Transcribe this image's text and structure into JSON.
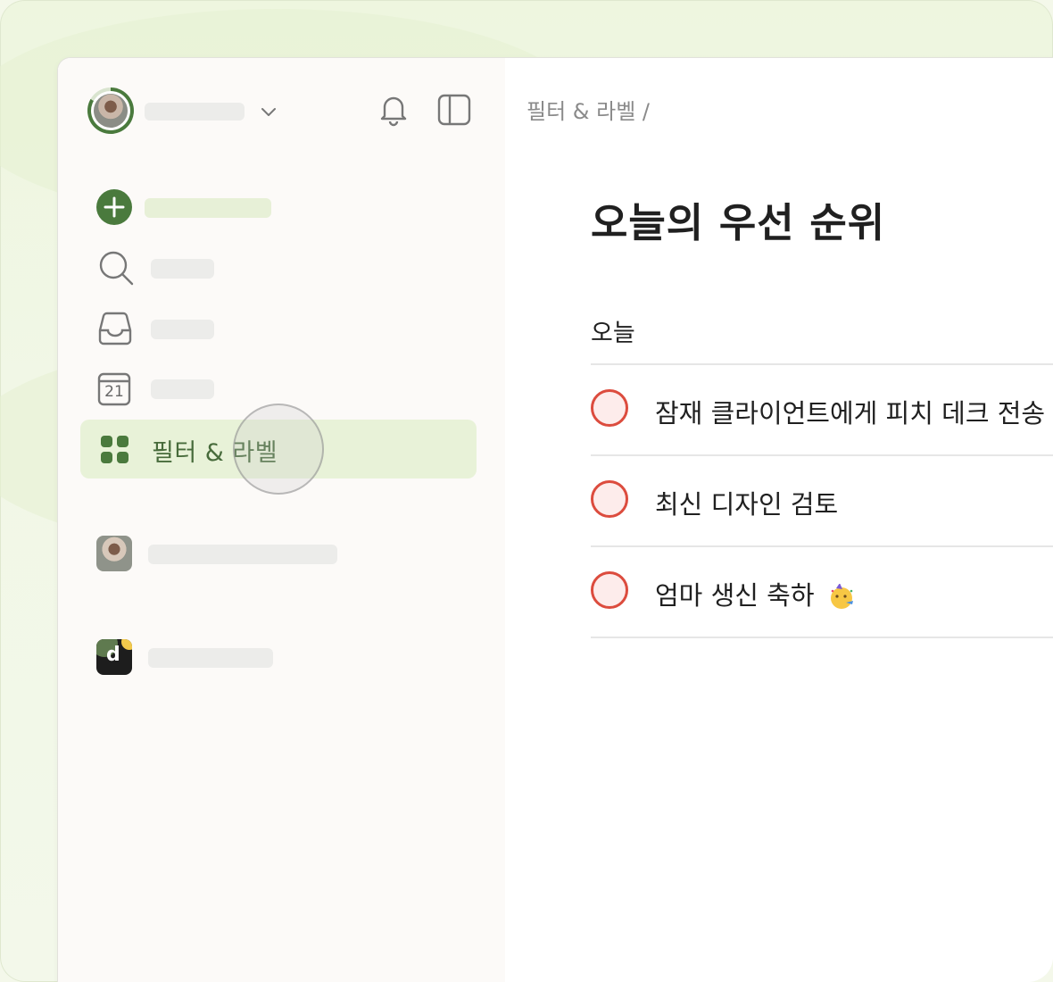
{
  "breadcrumb": "필터 & 라벨 /",
  "nav": {
    "filters_label": "필터 & 라벨"
  },
  "calendar_day": "21",
  "project_avatar_letter": "d",
  "page": {
    "title": "오늘의 우선 순위",
    "section": "오늘"
  },
  "tasks": [
    {
      "label": "잠재 클라이언트에게 피치 데크 전송"
    },
    {
      "label": "최신 디자인 검토"
    },
    {
      "label": "엄마 생신 축하"
    }
  ],
  "colors": {
    "accent_green": "#4a7a3d",
    "priority_red": "#dc4c3e",
    "active_bg": "#e8f2d8"
  },
  "icons": [
    "add-task-icon",
    "search-icon",
    "inbox-icon",
    "calendar-icon",
    "filters-labels-icon",
    "bell-icon",
    "sidebar-toggle-icon",
    "chevron-down-icon",
    "party-emoji-icon"
  ]
}
